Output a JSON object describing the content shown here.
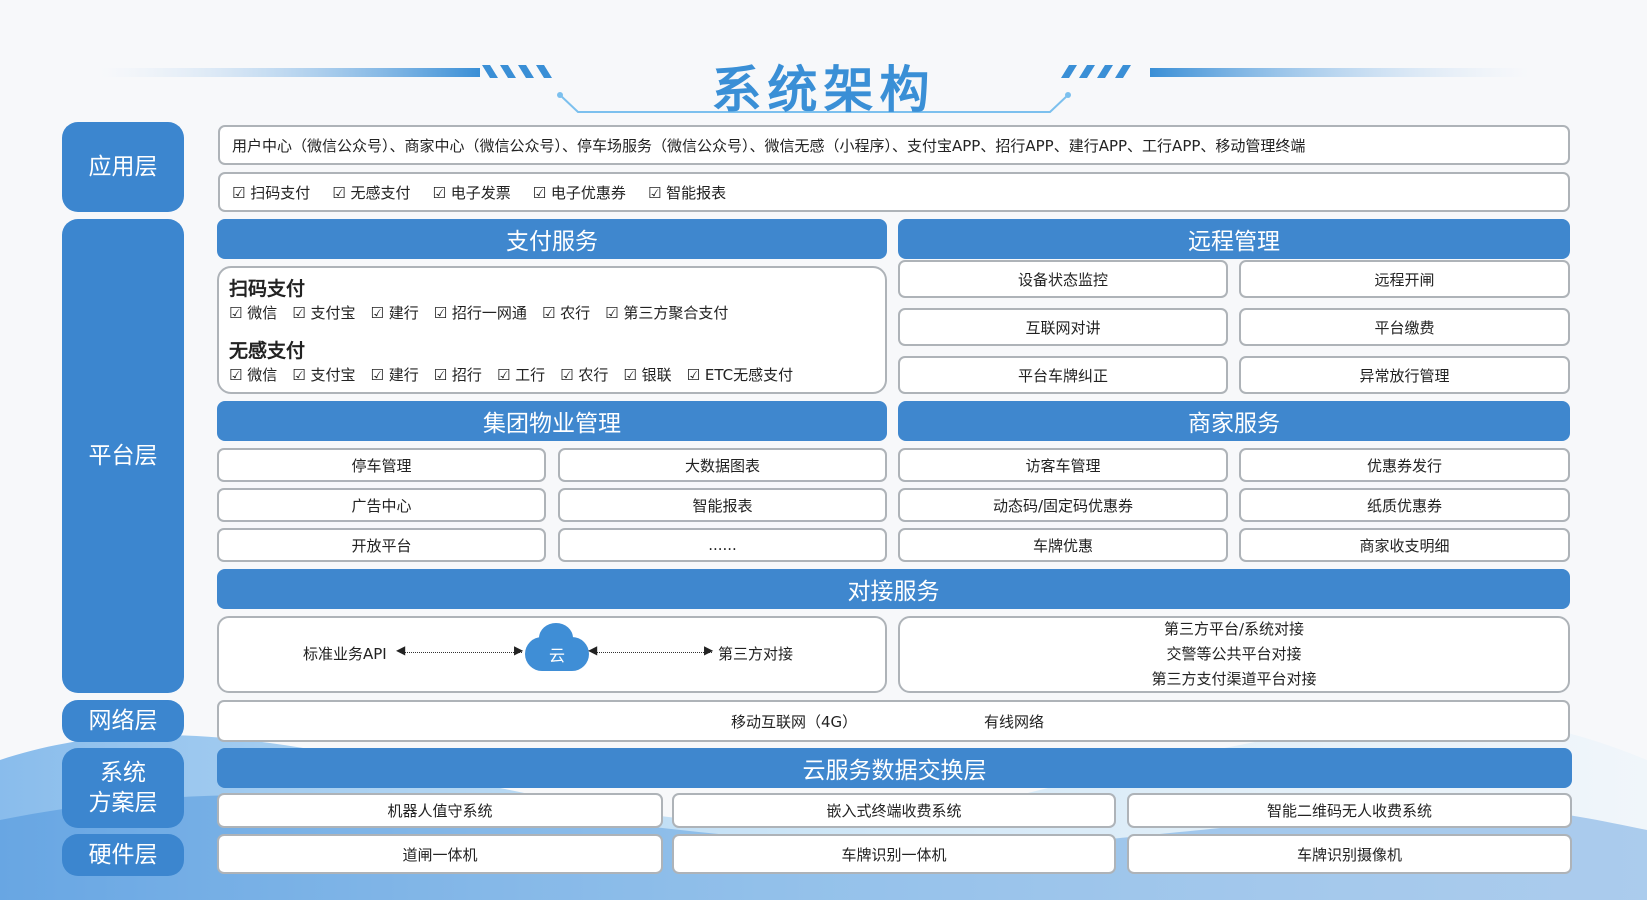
{
  "title": "系统架构",
  "colors": {
    "accent": "#3f87ce",
    "title": "#3a8fd6",
    "border": "#aeb3b8"
  },
  "layers": {
    "app": "应用层",
    "platform": "平台层",
    "network": "网络层",
    "solution_line1": "系统",
    "solution_line2": "方案层",
    "hardware": "硬件层"
  },
  "app_layer": {
    "entries": "用户中心（微信公众号）、商家中心（微信公众号）、停车场服务（微信公众号）、微信无感（小程序）、支付宝APP、招行APP、建行APP、工行APP、移动管理终端",
    "features": [
      "扫码支付",
      "无感支付",
      "电子发票",
      "电子优惠券",
      "智能报表"
    ]
  },
  "payment": {
    "header": "支付服务",
    "scan_title": "扫码支付",
    "scan_items": [
      "微信",
      "支付宝",
      "建行",
      "招行一网通",
      "农行",
      "第三方聚合支付"
    ],
    "nonsense_title": "无感支付",
    "nonsense_items": [
      "微信",
      "支付宝",
      "建行",
      "招行",
      "工行",
      "农行",
      "银联",
      "ETC无感支付"
    ]
  },
  "remote": {
    "header": "远程管理",
    "items": [
      "设备状态监控",
      "远程开闸",
      "互联网对讲",
      "平台缴费",
      "平台车牌纠正",
      "异常放行管理"
    ]
  },
  "group": {
    "header": "集团物业管理",
    "items": [
      "停车管理",
      "大数据图表",
      "广告中心",
      "智能报表",
      "开放平台",
      "......"
    ]
  },
  "merchant": {
    "header": "商家服务",
    "items": [
      "访客车管理",
      "优惠券发行",
      "动态码/固定码优惠券",
      "纸质优惠券",
      "车牌优惠",
      "商家收支明细"
    ]
  },
  "docking": {
    "header": "对接服务",
    "api_label": "标准业务API",
    "cloud_label": "云",
    "third_party_label": "第三方对接",
    "right_lines": [
      "第三方平台/系统对接",
      "交警等公共平台对接",
      "第三方支付渠道平台对接"
    ]
  },
  "network": {
    "mobile": "移动互联网（4G）",
    "wired": "有线网络"
  },
  "cloud_exchange": {
    "header": "云服务数据交换层",
    "solutions": [
      "机器人值守系统",
      "嵌入式终端收费系统",
      "智能二维码无人收费系统"
    ]
  },
  "hardware": {
    "items": [
      "道闸一体机",
      "车牌识别一体机",
      "车牌识别摄像机"
    ]
  }
}
